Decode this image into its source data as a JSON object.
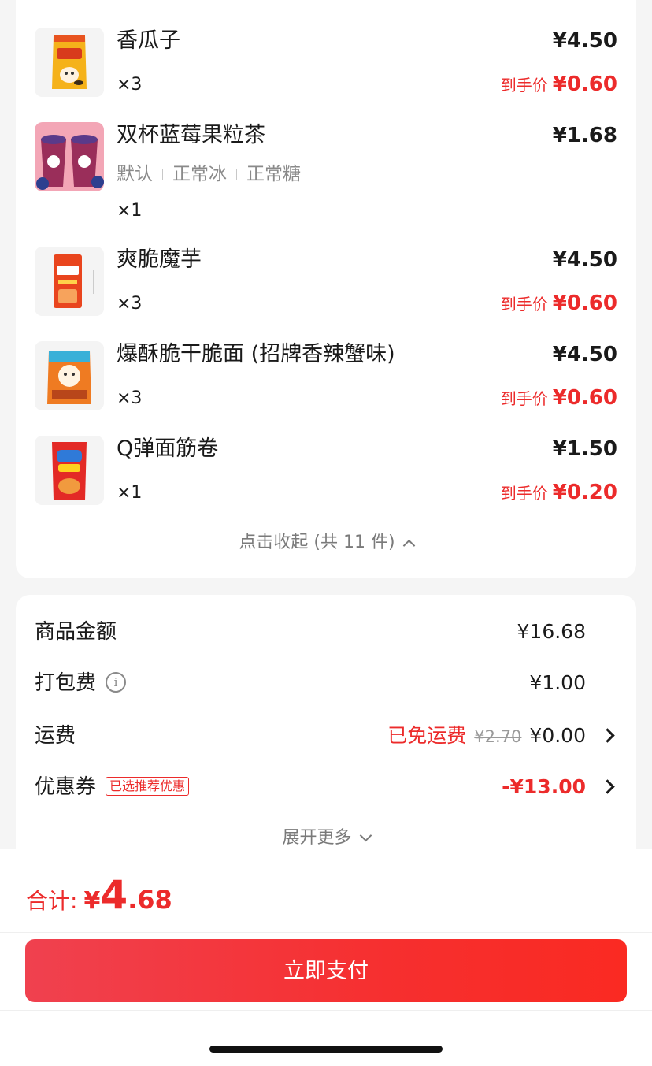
{
  "items": [
    {
      "name": "香瓜子",
      "price": "¥4.50",
      "qty": "×3",
      "deal_label": "到手价",
      "deal_price": "¥0.60",
      "icon": "sunflower-seeds-product-image"
    },
    {
      "name": "双杯蓝莓果粒茶",
      "price": "¥1.68",
      "qty": "×1",
      "specs": [
        "默认",
        "正常冰",
        "正常糖"
      ],
      "icon": "blueberry-tea-product-image"
    },
    {
      "name": "爽脆魔芋",
      "price": "¥4.50",
      "qty": "×3",
      "deal_label": "到手价",
      "deal_price": "¥0.60",
      "icon": "konjac-snack-product-image"
    },
    {
      "name": "爆酥脆干脆面 (招牌香辣蟹味)",
      "price": "¥4.50",
      "qty": "×3",
      "deal_label": "到手价",
      "deal_price": "¥0.60",
      "icon": "crispy-noodle-product-image"
    },
    {
      "name": "Q弹面筋卷",
      "price": "¥1.50",
      "qty": "×1",
      "deal_label": "到手价",
      "deal_price": "¥0.20",
      "icon": "gluten-roll-product-image"
    }
  ],
  "collapse_label": "点击收起 (共 11 件)",
  "summary": {
    "goods_label": "商品金额",
    "goods_value": "¥16.68",
    "packing_label": "打包费",
    "packing_value": "¥1.00",
    "shipping_label": "运费",
    "shipping_free_label": "已免运费",
    "shipping_original": "¥2.70",
    "shipping_value": "¥0.00",
    "coupon_label": "优惠券",
    "coupon_tag": "已选推荐优惠",
    "coupon_value": "-¥13.00",
    "expand_label": "展开更多"
  },
  "footer": {
    "total_label": "合计:",
    "total_currency": "¥",
    "total_int": "4",
    "total_dec": ".68",
    "pay_label": "立即支付"
  },
  "colors": {
    "accent_red": "#ec2b2b",
    "page_bg": "#f5f5f5"
  }
}
